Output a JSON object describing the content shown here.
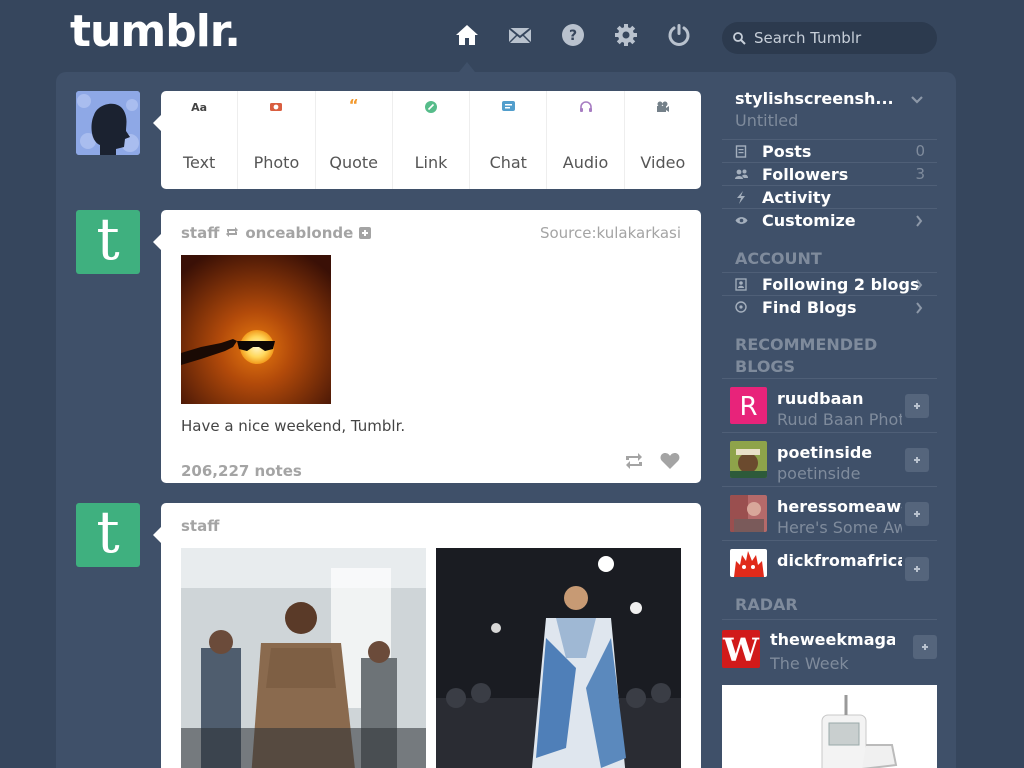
{
  "header": {
    "logo": "tumblr.",
    "nav": [
      {
        "icon": "home-icon"
      },
      {
        "icon": "mail-icon"
      },
      {
        "icon": "help-icon"
      },
      {
        "icon": "gear-icon"
      },
      {
        "icon": "power-icon"
      }
    ],
    "search_placeholder": "Search Tumblr"
  },
  "post_types": [
    {
      "label": "Text",
      "icon": "Aa",
      "color": "#444444"
    },
    {
      "label": "Photo",
      "icon": "camera-icon",
      "color": "#d95e40"
    },
    {
      "label": "Quote",
      "icon": "“",
      "color": "#f2992e"
    },
    {
      "label": "Link",
      "icon": "link-icon",
      "color": "#56bc8a"
    },
    {
      "label": "Chat",
      "icon": "chat-icon",
      "color": "#529ecc"
    },
    {
      "label": "Audio",
      "icon": "headphones-icon",
      "color": "#a77dc2"
    },
    {
      "label": "Video",
      "icon": "video-icon",
      "color": "#748089"
    }
  ],
  "posts": [
    {
      "author": "staff",
      "reblogged_from": "onceablonde",
      "source": "Source:kulakarkasi",
      "caption": "Have a nice weekend, Tumblr.",
      "notes": "206,227 notes"
    },
    {
      "author": "staff"
    }
  ],
  "sidebar": {
    "blog_name": "stylishscreensh...",
    "blog_title": "Untitled",
    "items": [
      {
        "label": "Posts",
        "count": "0",
        "icon": "document-icon"
      },
      {
        "label": "Followers",
        "count": "3",
        "icon": "people-icon"
      },
      {
        "label": "Activity",
        "count": "",
        "icon": "lightning-icon"
      },
      {
        "label": "Customize",
        "count": "",
        "icon": "eye-icon"
      }
    ],
    "account_heading": "ACCOUNT",
    "account_items": [
      {
        "label": "Following 2 blogs",
        "icon": "following-icon"
      },
      {
        "label": "Find Blogs",
        "icon": "compass-icon"
      }
    ],
    "recommended_heading": "RECOMMENDED BLOGS",
    "recommended": [
      {
        "name": "ruudbaan",
        "desc": "Ruud Baan Photography"
      },
      {
        "name": "poetinside",
        "desc": "poetinside"
      },
      {
        "name": "heressomeawesome",
        "desc": "Here's Some Awesome"
      },
      {
        "name": "dickfromafrica",
        "desc": ""
      }
    ],
    "radar_heading": "RADAR",
    "radar": {
      "name": "theweekmagazine",
      "desc": "The Week"
    }
  },
  "colors": {
    "background": "#36465d",
    "panel": "#3f5069",
    "accent_green": "#3fb07f"
  }
}
